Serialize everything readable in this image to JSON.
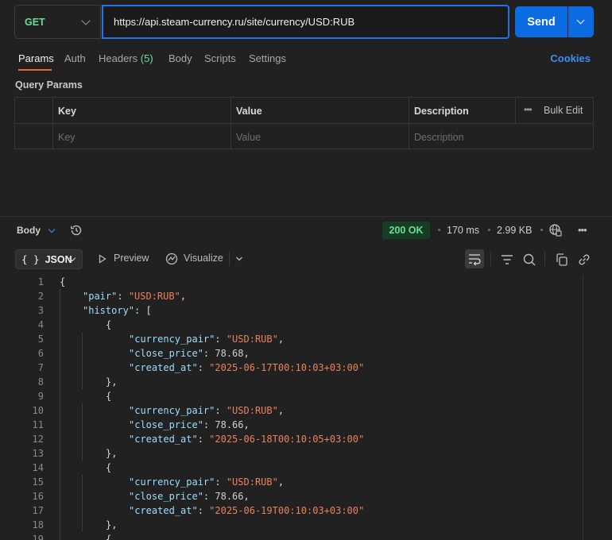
{
  "request": {
    "method": "GET",
    "url": "https://api.steam-currency.ru/site/currency/USD:RUB",
    "send_label": "Send"
  },
  "tabs": {
    "params": "Params",
    "auth": "Auth",
    "headers": "Headers",
    "headers_count": "(5)",
    "body": "Body",
    "scripts": "Scripts",
    "settings": "Settings",
    "cookies": "Cookies"
  },
  "query_params": {
    "title": "Query Params",
    "columns": [
      "Key",
      "Value",
      "Description"
    ],
    "bulk_edit": "Bulk Edit",
    "placeholders": [
      "Key",
      "Value",
      "Description"
    ]
  },
  "response": {
    "body_label": "Body",
    "status": "200 OK",
    "time": "170 ms",
    "size": "2.99 KB",
    "format": "JSON",
    "preview": "Preview",
    "visualize": "Visualize"
  },
  "code_lines": [
    {
      "n": "1",
      "indent": 0,
      "parts": [
        {
          "t": "{",
          "c": "p"
        }
      ]
    },
    {
      "n": "2",
      "indent": 1,
      "parts": [
        {
          "t": "\"pair\"",
          "c": "k"
        },
        {
          "t": ": ",
          "c": "p"
        },
        {
          "t": "\"USD:RUB\"",
          "c": "s"
        },
        {
          "t": ",",
          "c": "p"
        }
      ]
    },
    {
      "n": "3",
      "indent": 1,
      "parts": [
        {
          "t": "\"history\"",
          "c": "k"
        },
        {
          "t": ": [",
          "c": "p"
        }
      ]
    },
    {
      "n": "4",
      "indent": 2,
      "parts": [
        {
          "t": "{",
          "c": "p"
        }
      ]
    },
    {
      "n": "5",
      "indent": 3,
      "parts": [
        {
          "t": "\"currency_pair\"",
          "c": "k"
        },
        {
          "t": ": ",
          "c": "p"
        },
        {
          "t": "\"USD:RUB\"",
          "c": "s"
        },
        {
          "t": ",",
          "c": "p"
        }
      ]
    },
    {
      "n": "6",
      "indent": 3,
      "parts": [
        {
          "t": "\"close_price\"",
          "c": "k"
        },
        {
          "t": ": ",
          "c": "p"
        },
        {
          "t": "78.68",
          "c": "n"
        },
        {
          "t": ",",
          "c": "p"
        }
      ]
    },
    {
      "n": "7",
      "indent": 3,
      "parts": [
        {
          "t": "\"created_at\"",
          "c": "k"
        },
        {
          "t": ": ",
          "c": "p"
        },
        {
          "t": "\"2025-06-17T00:10:03+03:00\"",
          "c": "s"
        }
      ]
    },
    {
      "n": "8",
      "indent": 2,
      "parts": [
        {
          "t": "},",
          "c": "p"
        }
      ]
    },
    {
      "n": "9",
      "indent": 2,
      "parts": [
        {
          "t": "{",
          "c": "p"
        }
      ]
    },
    {
      "n": "10",
      "indent": 3,
      "parts": [
        {
          "t": "\"currency_pair\"",
          "c": "k"
        },
        {
          "t": ": ",
          "c": "p"
        },
        {
          "t": "\"USD:RUB\"",
          "c": "s"
        },
        {
          "t": ",",
          "c": "p"
        }
      ]
    },
    {
      "n": "11",
      "indent": 3,
      "parts": [
        {
          "t": "\"close_price\"",
          "c": "k"
        },
        {
          "t": ": ",
          "c": "p"
        },
        {
          "t": "78.66",
          "c": "n"
        },
        {
          "t": ",",
          "c": "p"
        }
      ]
    },
    {
      "n": "12",
      "indent": 3,
      "parts": [
        {
          "t": "\"created_at\"",
          "c": "k"
        },
        {
          "t": ": ",
          "c": "p"
        },
        {
          "t": "\"2025-06-18T00:10:05+03:00\"",
          "c": "s"
        }
      ]
    },
    {
      "n": "13",
      "indent": 2,
      "parts": [
        {
          "t": "},",
          "c": "p"
        }
      ]
    },
    {
      "n": "14",
      "indent": 2,
      "parts": [
        {
          "t": "{",
          "c": "p"
        }
      ]
    },
    {
      "n": "15",
      "indent": 3,
      "parts": [
        {
          "t": "\"currency_pair\"",
          "c": "k"
        },
        {
          "t": ": ",
          "c": "p"
        },
        {
          "t": "\"USD:RUB\"",
          "c": "s"
        },
        {
          "t": ",",
          "c": "p"
        }
      ]
    },
    {
      "n": "16",
      "indent": 3,
      "parts": [
        {
          "t": "\"close_price\"",
          "c": "k"
        },
        {
          "t": ": ",
          "c": "p"
        },
        {
          "t": "78.66",
          "c": "n"
        },
        {
          "t": ",",
          "c": "p"
        }
      ]
    },
    {
      "n": "17",
      "indent": 3,
      "parts": [
        {
          "t": "\"created_at\"",
          "c": "k"
        },
        {
          "t": ": ",
          "c": "p"
        },
        {
          "t": "\"2025-06-19T00:10:03+03:00\"",
          "c": "s"
        }
      ]
    },
    {
      "n": "18",
      "indent": 2,
      "parts": [
        {
          "t": "},",
          "c": "p"
        }
      ]
    },
    {
      "n": "19",
      "indent": 2,
      "parts": [
        {
          "t": "{",
          "c": "p"
        }
      ]
    }
  ],
  "colors": {
    "accent": "#0a6ce0",
    "method": "#6bdd9a",
    "tab_underline": "#e86a3a",
    "json_key": "#9cdcfe",
    "json_string": "#e8825c"
  }
}
